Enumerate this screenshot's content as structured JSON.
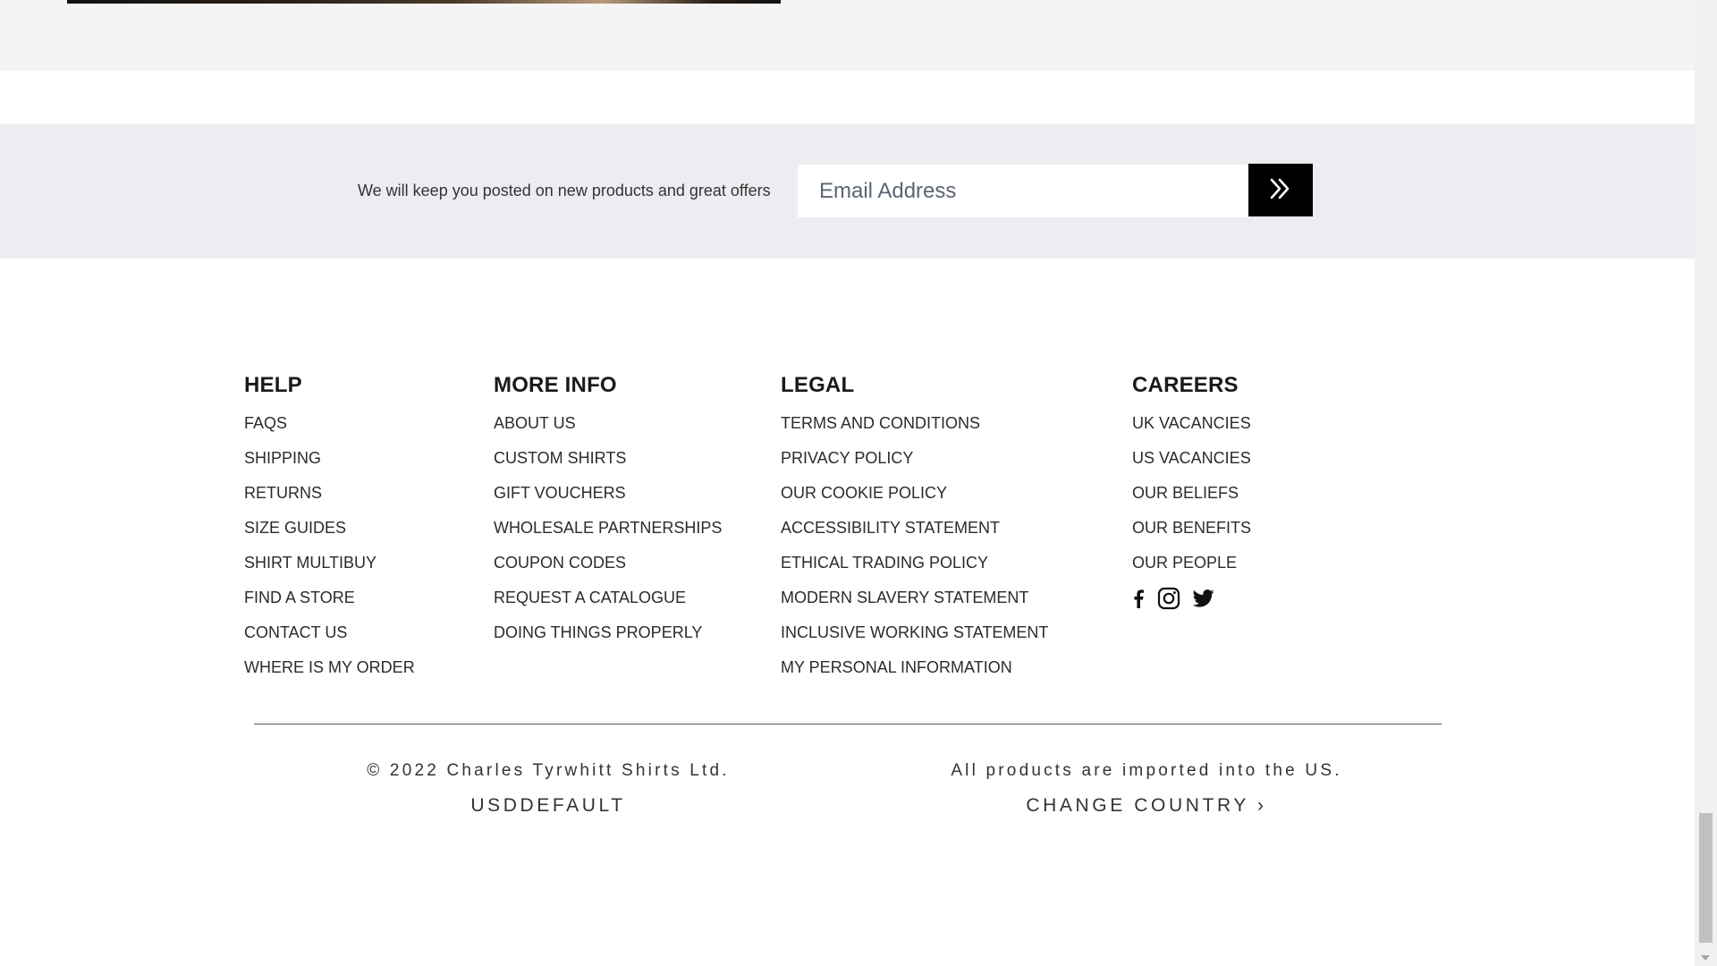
{
  "newsletter": {
    "text": "We will keep you posted on new products and great offers",
    "email_placeholder": "Email Address",
    "submit_icon": "double-chevron-right-icon"
  },
  "footer": {
    "columns": [
      {
        "heading": "HELP",
        "links": [
          "FAQS",
          "SHIPPING",
          "RETURNS",
          "SIZE GUIDES",
          "SHIRT MULTIBUY",
          "FIND A STORE",
          "CONTACT US",
          "WHERE IS MY ORDER"
        ]
      },
      {
        "heading": "MORE INFO",
        "links": [
          "ABOUT US",
          "CUSTOM SHIRTS",
          "GIFT VOUCHERS",
          "WHOLESALE PARTNERSHIPS",
          "COUPON CODES",
          "REQUEST A CATALOGUE",
          "DOING THINGS PROPERLY"
        ]
      },
      {
        "heading": "LEGAL",
        "links": [
          "TERMS AND CONDITIONS",
          "PRIVACY POLICY",
          "OUR COOKIE POLICY",
          "ACCESSIBILITY STATEMENT",
          "ETHICAL TRADING POLICY",
          "MODERN SLAVERY STATEMENT",
          "INCLUSIVE WORKING STATEMENT",
          "MY PERSONAL INFORMATION"
        ]
      },
      {
        "heading": "CAREERS",
        "links": [
          "UK VACANCIES",
          "US VACANCIES",
          "OUR BELIEFS",
          "OUR BENEFITS",
          "OUR PEOPLE"
        ]
      }
    ],
    "social_icons": [
      "facebook-icon",
      "instagram-icon",
      "twitter-icon"
    ]
  },
  "bottom": {
    "copyright": "© 2022 Charles Tyrwhitt Shirts Ltd.",
    "currency_label": "USDDEFAULT",
    "import_notice": "All products are imported into the US.",
    "change_country": "CHANGE COUNTRY ›"
  },
  "colors": {
    "newsletter_bg": "#ebedf1",
    "button_bg": "#000000",
    "top_bg": "#f4f4f4"
  }
}
